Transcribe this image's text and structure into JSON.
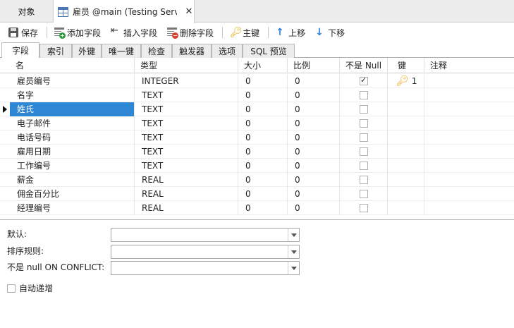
{
  "doc_tabs": [
    {
      "label": "对象"
    },
    {
      "label": "雇员 @main (Testing Serv..."
    }
  ],
  "toolbar": {
    "save": "保存",
    "add_field": "添加字段",
    "insert_field": "插入字段",
    "delete_field": "删除字段",
    "primary_key": "主键",
    "move_up": "上移",
    "move_down": "下移"
  },
  "sub_tabs": [
    "字段",
    "索引",
    "外键",
    "唯一键",
    "检查",
    "触发器",
    "选项",
    "SQL 预览"
  ],
  "columns": [
    "名",
    "类型",
    "大小",
    "比例",
    "不是 Null",
    "键",
    "注释"
  ],
  "rows": [
    {
      "name": "雇员编号",
      "type": "INTEGER",
      "size": "0",
      "scale": "0",
      "not_null": true,
      "key": "1"
    },
    {
      "name": "名字",
      "type": "TEXT",
      "size": "0",
      "scale": "0",
      "not_null": false,
      "key": ""
    },
    {
      "name": "姓氏",
      "type": "TEXT",
      "size": "0",
      "scale": "0",
      "not_null": false,
      "key": ""
    },
    {
      "name": "电子邮件",
      "type": "TEXT",
      "size": "0",
      "scale": "0",
      "not_null": false,
      "key": ""
    },
    {
      "name": "电话号码",
      "type": "TEXT",
      "size": "0",
      "scale": "0",
      "not_null": false,
      "key": ""
    },
    {
      "name": "雇用日期",
      "type": "TEXT",
      "size": "0",
      "scale": "0",
      "not_null": false,
      "key": ""
    },
    {
      "name": "工作编号",
      "type": "TEXT",
      "size": "0",
      "scale": "0",
      "not_null": false,
      "key": ""
    },
    {
      "name": "薪金",
      "type": "REAL",
      "size": "0",
      "scale": "0",
      "not_null": false,
      "key": ""
    },
    {
      "name": "佣金百分比",
      "type": "REAL",
      "size": "0",
      "scale": "0",
      "not_null": false,
      "key": ""
    },
    {
      "name": "经理编号",
      "type": "REAL",
      "size": "0",
      "scale": "0",
      "not_null": false,
      "key": ""
    }
  ],
  "selected_row": 2,
  "props": {
    "default_label": "默认:",
    "collation_label": "排序规则:",
    "conflict_label": "不是 null ON CONFLICT:",
    "default_value": "",
    "collation_value": "",
    "conflict_value": "",
    "auto_increment_label": "自动递增",
    "auto_increment": false
  }
}
